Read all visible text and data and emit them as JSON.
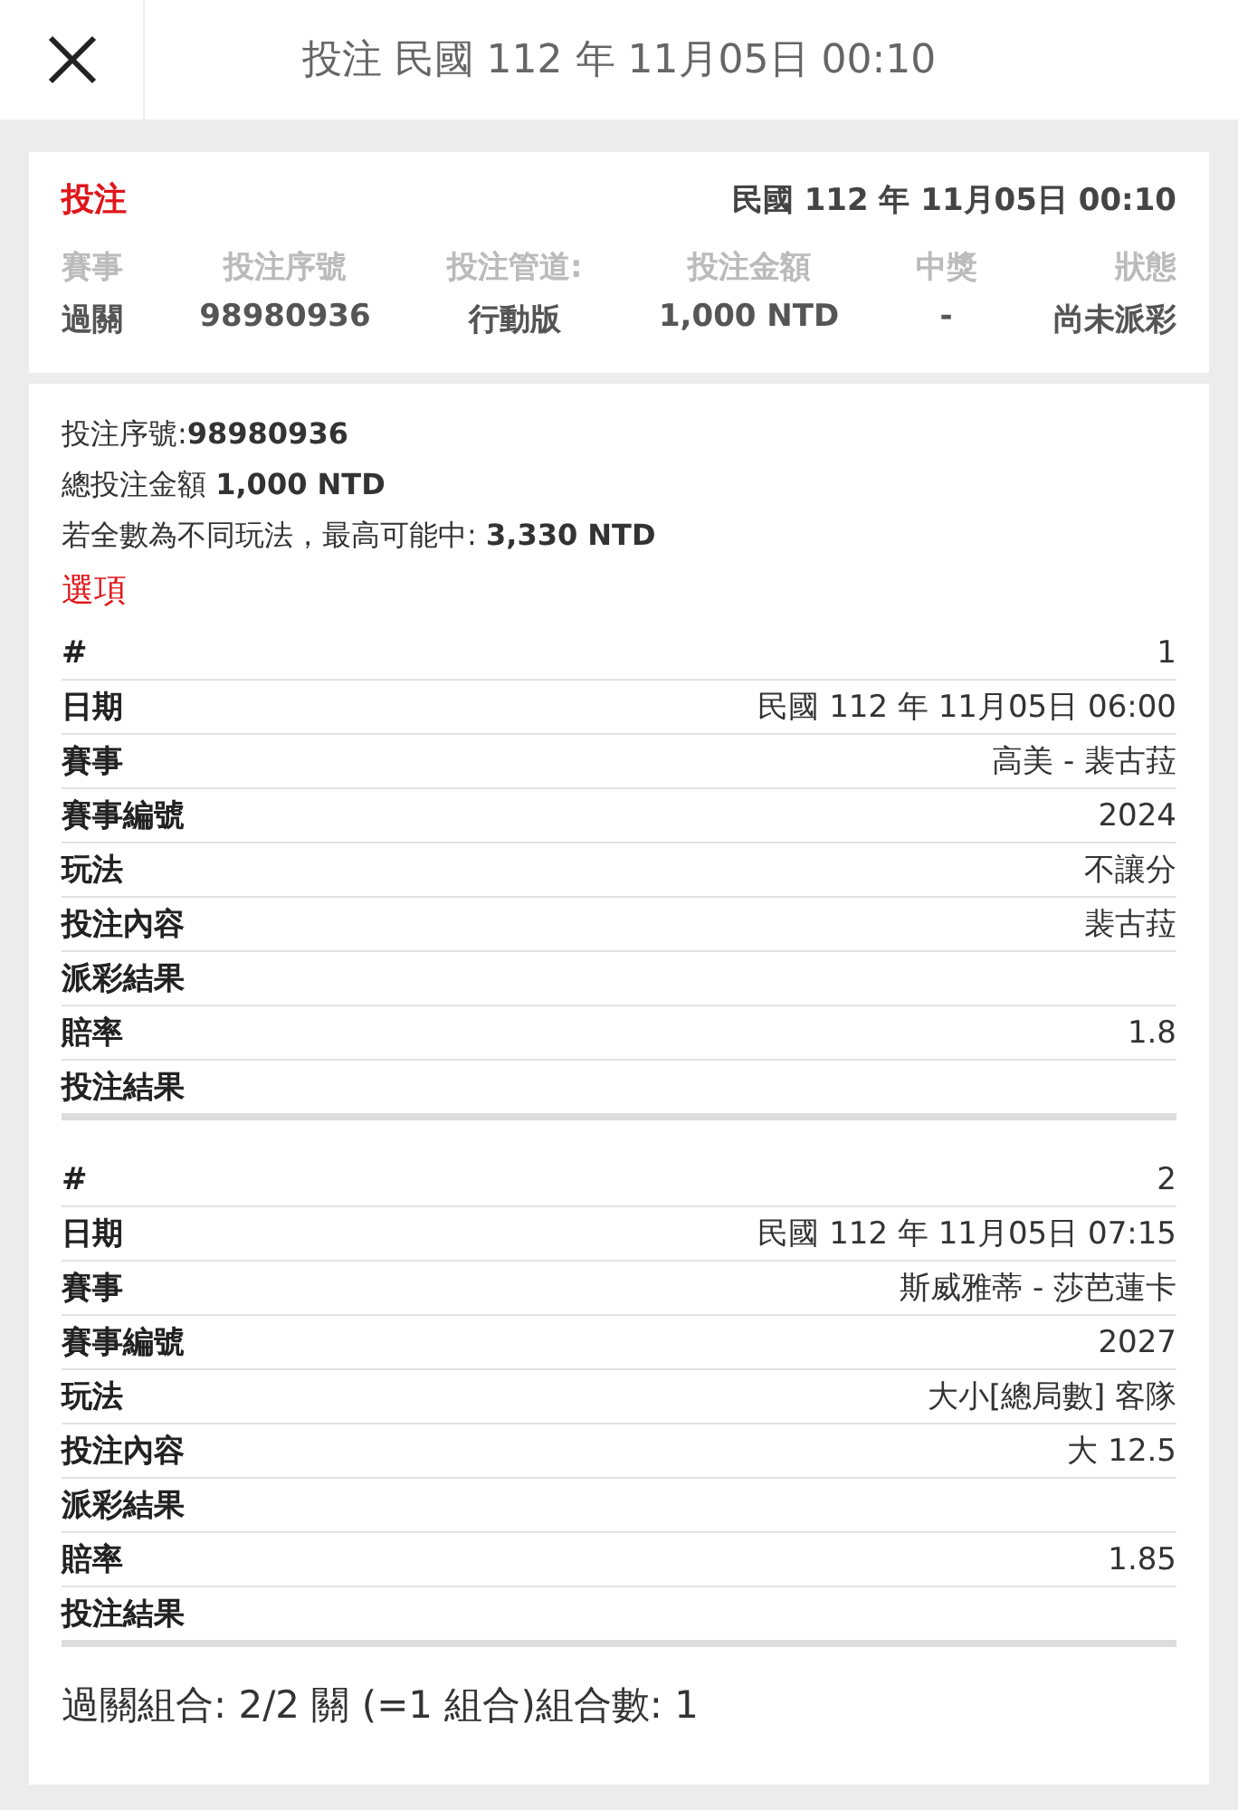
{
  "header": {
    "title": "投注 民國 112 年 11月05日 00:10"
  },
  "summary_card": {
    "type_label": "投注",
    "datetime": "民國 112 年 11月05日 00:10",
    "columns": [
      {
        "label": "賽事",
        "value": "過關"
      },
      {
        "label": "投注序號",
        "value": "98980936"
      },
      {
        "label": "投注管道:",
        "value": "行動版"
      },
      {
        "label": "投注金額",
        "value": "1,000 NTD"
      },
      {
        "label": "中獎",
        "value": "-"
      },
      {
        "label": "狀態",
        "value": "尚未派彩"
      }
    ]
  },
  "details": {
    "lines": [
      "投注序號:**98980936**",
      "總投注金額 **1,000 NTD**",
      "若全數為不同玩法，最高可能中: **3,330 NTD**"
    ],
    "options_title": "選項",
    "selections": [
      {
        "rows": [
          {
            "label": "#",
            "value": "1"
          },
          {
            "label": "日期",
            "value": "民國 112 年 11月05日 06:00"
          },
          {
            "label": "賽事",
            "value": "高美 - 裴古菈"
          },
          {
            "label": "賽事編號",
            "value": "2024"
          },
          {
            "label": "玩法",
            "value": "不讓分"
          },
          {
            "label": "投注內容",
            "value": "裴古菈"
          },
          {
            "label": "派彩結果",
            "value": ""
          },
          {
            "label": "賠率",
            "value": "1.8"
          },
          {
            "label": "投注結果",
            "value": ""
          }
        ]
      },
      {
        "rows": [
          {
            "label": "#",
            "value": "2"
          },
          {
            "label": "日期",
            "value": "民國 112 年 11月05日 07:15"
          },
          {
            "label": "賽事",
            "value": "斯威雅蒂 - 莎芭蓮卡"
          },
          {
            "label": "賽事編號",
            "value": "2027"
          },
          {
            "label": "玩法",
            "value": "大小[總局數] 客隊"
          },
          {
            "label": "投注內容",
            "value": "大 12.5"
          },
          {
            "label": "派彩結果",
            "value": ""
          },
          {
            "label": "賠率",
            "value": "1.85"
          },
          {
            "label": "投注結果",
            "value": ""
          }
        ]
      }
    ],
    "combination": "過關組合: 2/2 關 (=1 組合)組合數: 1"
  }
}
